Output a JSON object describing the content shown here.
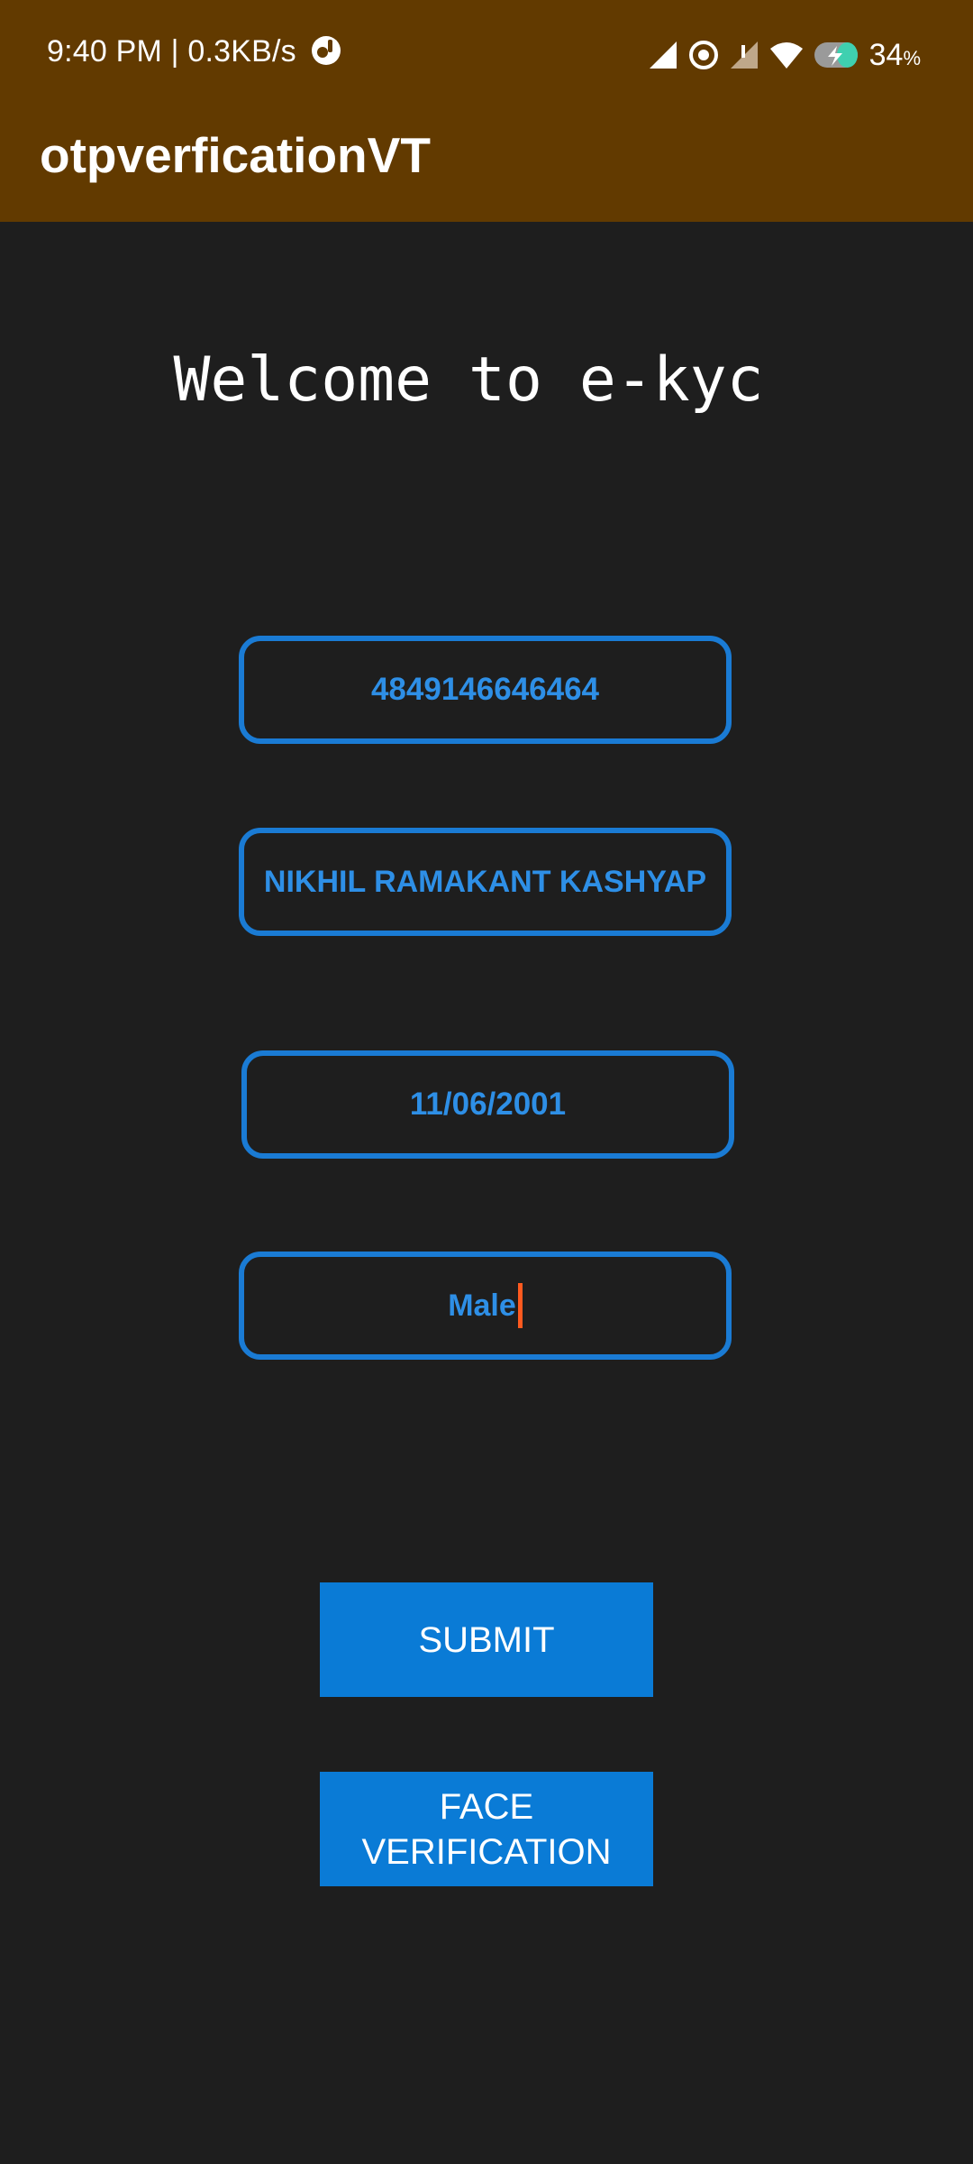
{
  "status_bar": {
    "time_speed": "9:40 PM | 0.3KB/s",
    "battery": "34",
    "battery_unit": "%"
  },
  "app_bar": {
    "title": "otpverficationVT"
  },
  "welcome": "Welcome to e-kyc",
  "fields": {
    "id_number": "4849146646464",
    "name": "NIKHIL RAMAKANT KASHYAP",
    "dob": "11/06/2001",
    "gender": "Male"
  },
  "buttons": {
    "submit": "SUBMIT",
    "face_verification_line1": "FACE",
    "face_verification_line2": "VERIFICATION"
  },
  "colors": {
    "app_bar": "#623a00",
    "background": "#1e1e1e",
    "accent_blue": "#0a7bd6",
    "field_text": "#2e8fe6",
    "caret": "#ff5a1f"
  },
  "icons": [
    "notification-badge-icon",
    "signal-icon",
    "hotspot-icon",
    "sim-icon",
    "wifi-icon",
    "battery-charging-icon"
  ]
}
